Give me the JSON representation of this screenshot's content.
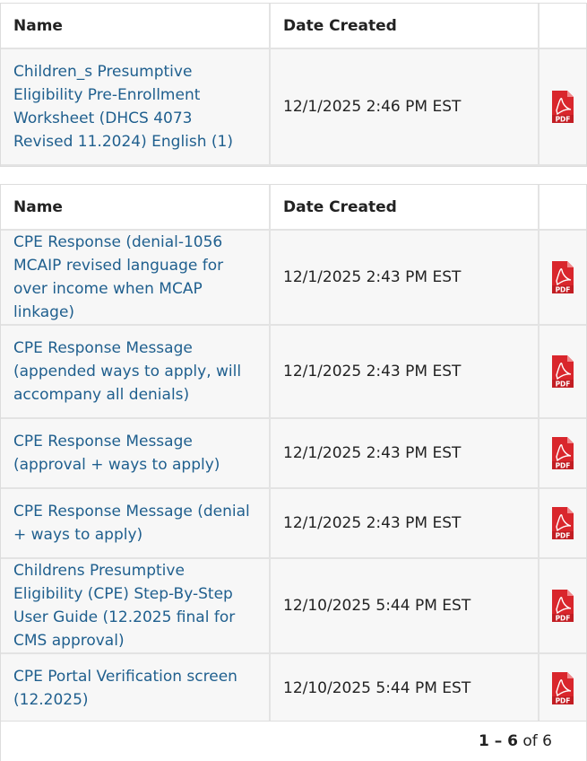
{
  "colors": {
    "link": "#1f5f8e",
    "row_bg": "#f7f7f7",
    "border": "#e3e3e3",
    "pdf_red": "#d9262c"
  },
  "table1": {
    "headers": {
      "name": "Name",
      "date": "Date Created"
    },
    "rows": [
      {
        "name": "Children_s Presumptive Eligibility Pre-Enrollment Worksheet (DHCS 4073 Revised 11.2024) English (1)",
        "date": "12/1/2025 2:46 PM EST",
        "icon": "pdf-file-icon"
      }
    ]
  },
  "table2": {
    "headers": {
      "name": "Name",
      "date": "Date Created"
    },
    "rows": [
      {
        "name": "CPE Response (denial-1056 MCAIP revised language for over income when MCAP linkage)",
        "date": "12/1/2025 2:43 PM EST",
        "icon": "pdf-file-icon"
      },
      {
        "name": "CPE Response Message (appended ways to apply, will accompany all denials)",
        "date": "12/1/2025 2:43 PM EST",
        "icon": "pdf-file-icon"
      },
      {
        "name": "CPE Response Message (approval + ways to apply)",
        "date": "12/1/2025 2:43 PM EST",
        "icon": "pdf-file-icon"
      },
      {
        "name": "CPE Response Message (denial + ways to apply)",
        "date": "12/1/2025 2:43 PM EST",
        "icon": "pdf-file-icon"
      },
      {
        "name": "Childrens Presumptive Eligibility (CPE) Step-By-Step User Guide (12.2025 final for CMS approval)",
        "date": "12/10/2025 5:44 PM EST",
        "icon": "pdf-file-icon"
      },
      {
        "name": "CPE Portal Verification screen (12.2025)",
        "date": "12/10/2025 5:44 PM EST",
        "icon": "pdf-file-icon"
      }
    ]
  },
  "pagination": {
    "range": "1 – 6",
    "of_text": "of 6"
  }
}
